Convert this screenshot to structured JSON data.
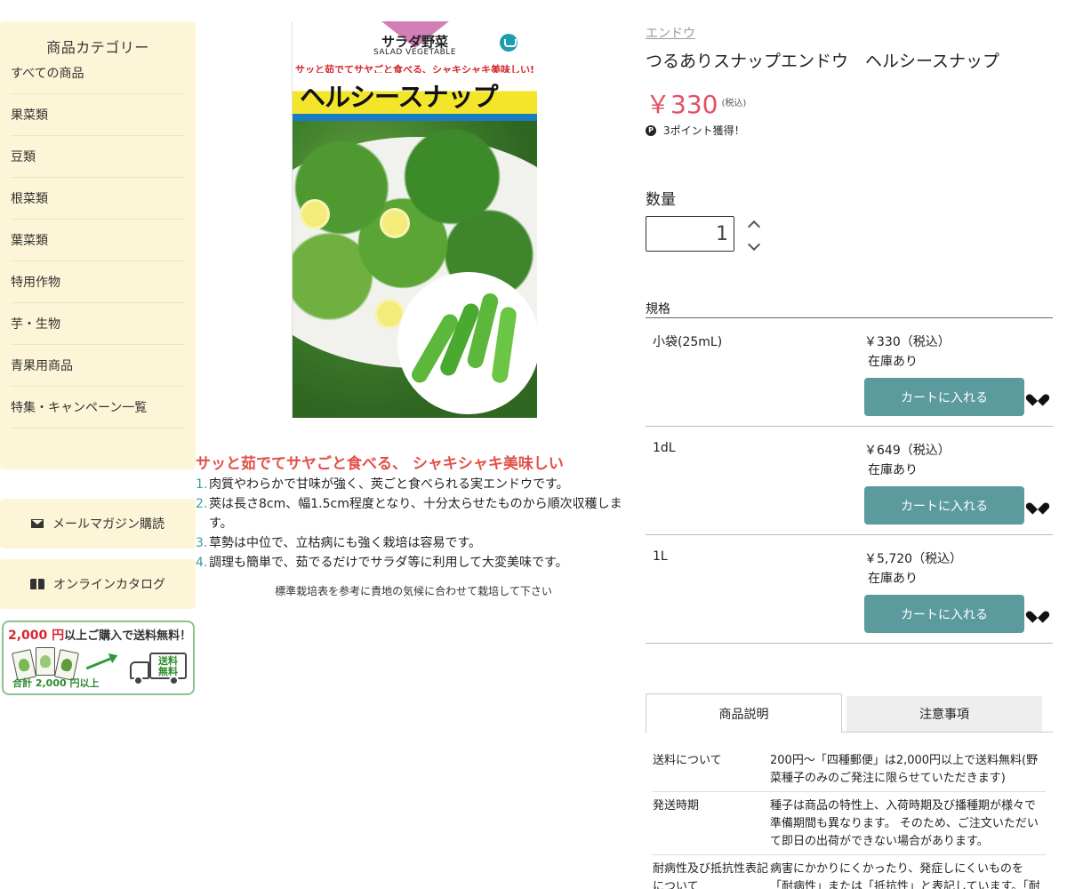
{
  "sidebar": {
    "category_title": "商品カテゴリー",
    "categories": [
      "すべての商品",
      "果菜類",
      "豆類",
      "根菜類",
      "葉菜類",
      "特用作物",
      "芋・生物",
      "青果用商品",
      "特集・キャンペーン一覧"
    ],
    "mail_button": "メールマガジン購読",
    "catalog_button": "オンラインカタログ",
    "shipping_banner": {
      "amount": "2,000 円",
      "text": "以上ご購入で送料無料！",
      "sub": "合計 2,000 円以上",
      "truck_line1": "送料",
      "truck_line2": "無料"
    }
  },
  "package": {
    "category": "サラダ野菜",
    "category_en": "SALAD VEGETABLE",
    "tagline": "サッと茹でてサヤごと食べる、シャキシャキ美味しい!",
    "name": "ヘルシースナップ"
  },
  "description": {
    "headline": "サッと茹でてサヤごと食べる、 シャキシャキ美味しい",
    "points": [
      {
        "num": "1.",
        "text": "肉質やわらかで甘味が強く、莢ごと食べられる実エンドウです。"
      },
      {
        "num": "2.",
        "text": "莢は長さ8cm、幅1.5cm程度となり、十分太らせたものから順次収穫します。"
      },
      {
        "num": "3.",
        "text": "草勢は中位で、立枯病にも強く栽培は容易です。"
      },
      {
        "num": "4.",
        "text": "調理も簡単で、茹でるだけでサラダ等に利用して大変美味です。"
      }
    ],
    "note": "標準栽培表を参考に貴地の気候に合わせて栽培して下さい"
  },
  "product": {
    "breadcrumb": "エンドウ",
    "title": "つるありスナップエンドウ　ヘルシースナップ",
    "price": "￥330",
    "tax_label": "(税込)",
    "points_icon": "P",
    "points_text": "3ポイント獲得！",
    "qty_label": "数量",
    "qty_value": "1"
  },
  "specs": {
    "label": "規格",
    "rows": [
      {
        "name": "小袋(25mL)",
        "price": "￥330（税込）",
        "stock": "在庫あり",
        "button": "カートに入れる"
      },
      {
        "name": "1dL",
        "price": "￥649（税込）",
        "stock": "在庫あり",
        "button": "カートに入れる"
      },
      {
        "name": "1L",
        "price": "￥5,720（税込）",
        "stock": "在庫あり",
        "button": "カートに入れる"
      }
    ]
  },
  "tabs": {
    "description": "商品説明",
    "notes": "注意事項"
  },
  "info": [
    {
      "key": "送料について",
      "value": "200円～「四種郵便」は2,000円以上で送料無料(野菜種子のみのご発注に限らせていただきます)"
    },
    {
      "key": "発送時期",
      "value": "種子は商品の特性上、入荷時期及び播種期が様々で準備期間も異なります。 そのため、ご注文いただいて即日の出荷ができない場合があります。"
    },
    {
      "key": "耐病性及び抵抗性表記について",
      "value": "病害にかかりにくかったり、発症しにくいものを「耐病性」または「抵抗性」と表記しています。「耐病性」"
    }
  ],
  "colors": {
    "sidebar_bg": "#fdf5d7",
    "price": "#e25065",
    "cart_button": "#5b9b9e",
    "headline": "#e25048",
    "list_number": "#3b9c9c"
  }
}
